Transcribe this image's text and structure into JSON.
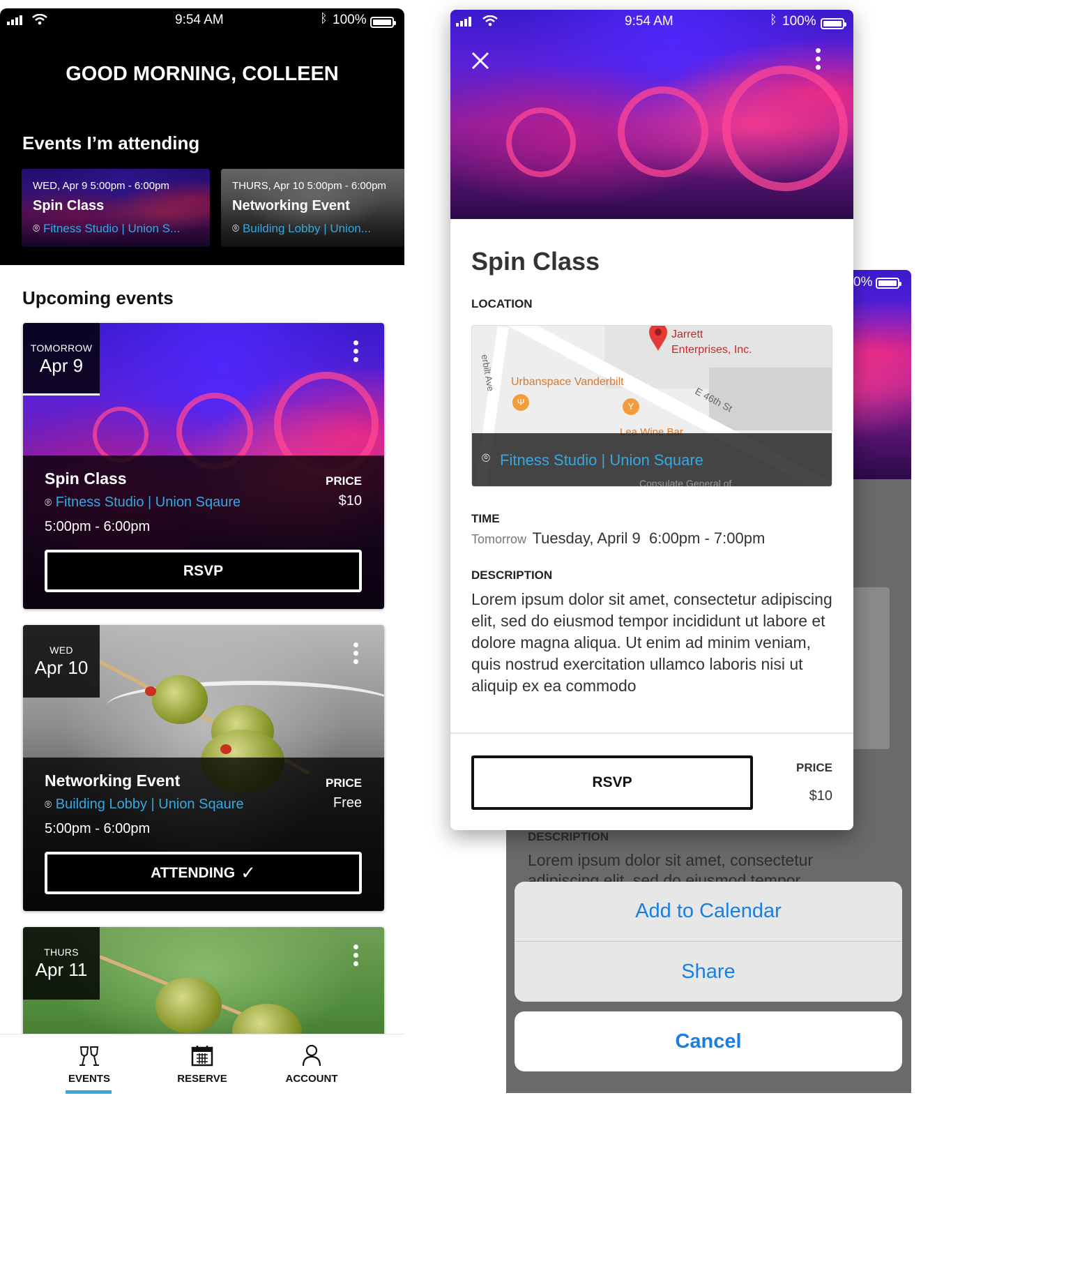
{
  "left_phone": {
    "status": {
      "time": "9:54 AM",
      "battery": "100%"
    },
    "greeting": "GOOD MORNING, COLLEEN",
    "attending_heading": "Events I’m attending",
    "attending": [
      {
        "time": "WED, Apr 9   5:00pm - 6:00pm",
        "name": "Spin Class",
        "location": "Fitness Studio | Union S..."
      },
      {
        "time": "THURS, Apr 10   5:00pm - 6:00pm",
        "name": "Networking Event",
        "location": "Building Lobby | Union..."
      }
    ],
    "upcoming_heading": "Upcoming events",
    "events": [
      {
        "day": "TOMORROW",
        "date": "Apr 9",
        "name": "Spin Class",
        "location": "Fitness Studio | Union Sqaure",
        "time": "5:00pm - 6:00pm",
        "price_label": "PRICE",
        "price": "$10",
        "button": "RSVP"
      },
      {
        "day": "WED",
        "date": "Apr 10",
        "name": "Networking Event",
        "location": "Building Lobby | Union Sqaure",
        "time": "5:00pm - 6:00pm",
        "price_label": "PRICE",
        "price": "Free",
        "button": "ATTENDING"
      },
      {
        "day": "THURS",
        "date": "Apr 11"
      }
    ],
    "tabs": [
      {
        "label": "EVENTS",
        "icon": "glasses-icon",
        "active": true
      },
      {
        "label": "RESERVE",
        "icon": "calendar-icon",
        "active": false
      },
      {
        "label": "ACCOUNT",
        "icon": "person-icon",
        "active": false
      }
    ]
  },
  "detail": {
    "status": {
      "time": "9:54 AM",
      "battery": "100%"
    },
    "title": "Spin Class",
    "location_label": "LOCATION",
    "map_labels": {
      "poi1": "Jarrett",
      "poi1b": "Enterprises, Inc.",
      "poi2": "Urbanspace Vanderbilt",
      "street": "E 46th St",
      "street2": "erbilt Ave",
      "poi3": "Lea Wine Bar",
      "poi4": "Consulate General of"
    },
    "location": "Fitness Studio | Union Square",
    "time_label": "TIME",
    "time_relative": "Tomorrow",
    "time_value": "Tuesday, April 9  6:00pm - 7:00pm",
    "description_label": "DESCRIPTION",
    "description": "Lorem ipsum dolor sit amet, consectetur adipiscing elit, sed do eiusmod tempor incididunt ut labore et dolore magna aliqua. Ut enim ad minim veniam, quis nostrud exercitation ullamco laboris nisi ut aliquip ex ea commodo",
    "rsvp": "RSVP",
    "price_label": "PRICE",
    "price": "$10"
  },
  "background_screen": {
    "battery_fragment": "0%",
    "description_label": "DESCRIPTION",
    "description_fragment": "Lorem ipsum dolor sit amet, consectetur",
    "description_cut": "adipiscing elit, sed do eiusmod tempor"
  },
  "action_sheet": {
    "items": [
      "Add to Calendar",
      "Share"
    ],
    "cancel": "Cancel"
  },
  "colors": {
    "accent_blue": "#35a8e0",
    "ios_blue": "#1a7fe0",
    "tab_indicator": "#35a8e0"
  }
}
